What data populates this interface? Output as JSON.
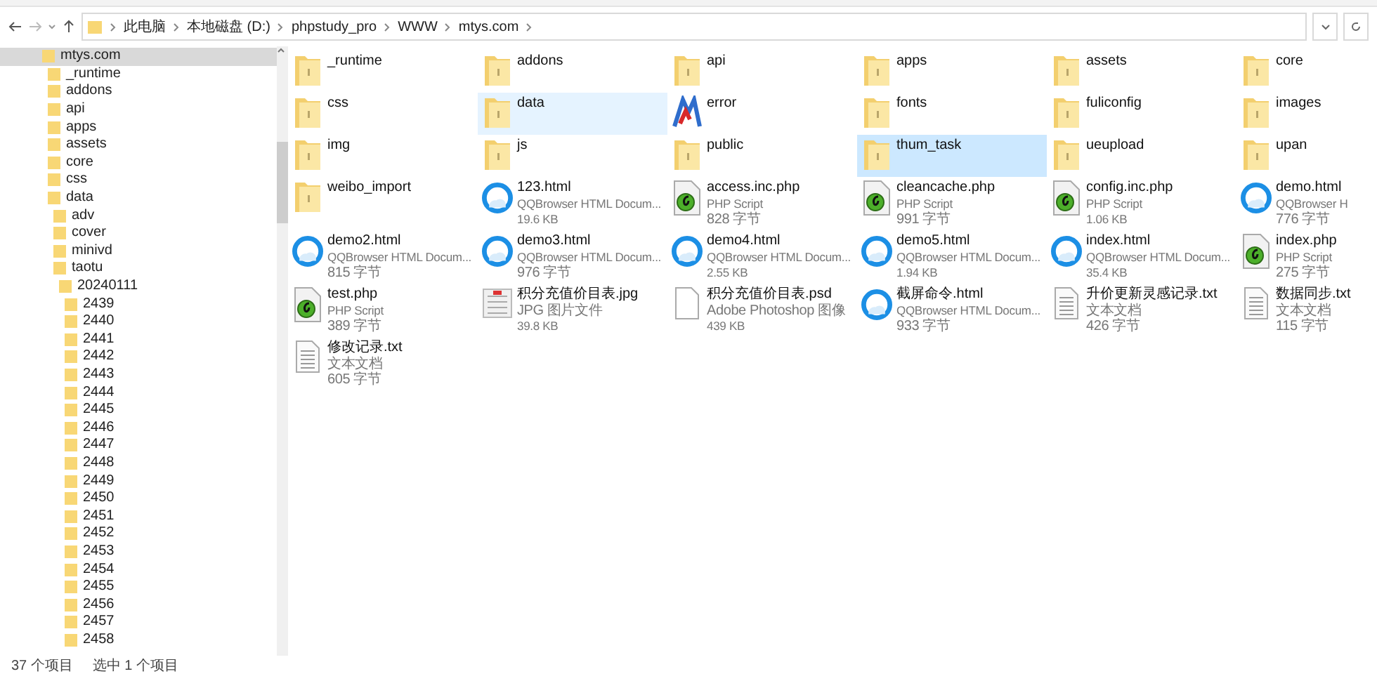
{
  "breadcrumb": [
    "此电脑",
    "本地磁盘 (D:)",
    "phpstudy_pro",
    "WWW",
    "mtys.com"
  ],
  "tree": [
    {
      "label": "mtys.com",
      "selected": true,
      "children": [
        {
          "label": "_runtime",
          "selected": false
        },
        {
          "label": "addons",
          "selected": false
        },
        {
          "label": "api",
          "selected": false
        },
        {
          "label": "apps",
          "selected": false
        },
        {
          "label": "assets",
          "selected": false
        },
        {
          "label": "core",
          "selected": false
        },
        {
          "label": "css",
          "selected": false
        },
        {
          "label": "data",
          "selected": false,
          "children": [
            {
              "label": "adv",
              "selected": false
            },
            {
              "label": "cover",
              "selected": false
            },
            {
              "label": "minivd",
              "selected": false
            },
            {
              "label": "taotu",
              "selected": false,
              "children": [
                {
                  "label": "20240111",
                  "selected": false,
                  "children": [
                    {
                      "label": "2439",
                      "selected": false
                    },
                    {
                      "label": "2440",
                      "selected": false
                    },
                    {
                      "label": "2441",
                      "selected": false
                    },
                    {
                      "label": "2442",
                      "selected": false
                    },
                    {
                      "label": "2443",
                      "selected": false
                    },
                    {
                      "label": "2444",
                      "selected": false
                    },
                    {
                      "label": "2445",
                      "selected": false
                    },
                    {
                      "label": "2446",
                      "selected": false
                    },
                    {
                      "label": "2447",
                      "selected": false
                    },
                    {
                      "label": "2448",
                      "selected": false
                    },
                    {
                      "label": "2449",
                      "selected": false
                    },
                    {
                      "label": "2450",
                      "selected": false
                    },
                    {
                      "label": "2451",
                      "selected": false
                    },
                    {
                      "label": "2452",
                      "selected": false
                    },
                    {
                      "label": "2453",
                      "selected": false
                    },
                    {
                      "label": "2454",
                      "selected": false
                    },
                    {
                      "label": "2455",
                      "selected": false
                    },
                    {
                      "label": "2456",
                      "selected": false
                    },
                    {
                      "label": "2457",
                      "selected": false
                    },
                    {
                      "label": "2458",
                      "selected": false
                    }
                  ]
                }
              ]
            }
          ]
        }
      ]
    }
  ],
  "items": [
    {
      "kind": "folder",
      "name": "_runtime",
      "selected": false,
      "hovered": false
    },
    {
      "kind": "folder",
      "name": "addons",
      "selected": false,
      "hovered": false
    },
    {
      "kind": "folder",
      "name": "api",
      "selected": false,
      "hovered": false
    },
    {
      "kind": "folder",
      "name": "apps",
      "selected": false,
      "hovered": false
    },
    {
      "kind": "folder",
      "name": "assets",
      "selected": false,
      "hovered": false
    },
    {
      "kind": "folder",
      "name": "core",
      "selected": false,
      "hovered": false
    },
    {
      "kind": "folder",
      "name": "css",
      "selected": false,
      "hovered": false
    },
    {
      "kind": "folder",
      "name": "data",
      "selected": false,
      "hovered": true
    },
    {
      "kind": "app",
      "name": "error",
      "selected": false,
      "hovered": false
    },
    {
      "kind": "folder",
      "name": "fonts",
      "selected": false,
      "hovered": false
    },
    {
      "kind": "folder",
      "name": "fuliconfig",
      "selected": false,
      "hovered": false
    },
    {
      "kind": "folder",
      "name": "images",
      "selected": false,
      "hovered": false
    },
    {
      "kind": "folder",
      "name": "img",
      "selected": false,
      "hovered": false
    },
    {
      "kind": "folder",
      "name": "js",
      "selected": false,
      "hovered": false
    },
    {
      "kind": "folder",
      "name": "public",
      "selected": false,
      "hovered": false
    },
    {
      "kind": "folder",
      "name": "thum_task",
      "selected": true,
      "hovered": false
    },
    {
      "kind": "folder",
      "name": "ueupload",
      "selected": false,
      "hovered": false
    },
    {
      "kind": "folder",
      "name": "upan",
      "selected": false,
      "hovered": false
    },
    {
      "kind": "folder",
      "name": "weibo_import",
      "selected": false,
      "hovered": false
    },
    {
      "kind": "html",
      "name": "123.html",
      "type": "QQBrowser HTML Docum...",
      "size": "19.6 KB",
      "selected": false,
      "hovered": false
    },
    {
      "kind": "php",
      "name": "access.inc.php",
      "type": "PHP Script",
      "size": "828 字节",
      "selected": false,
      "hovered": false
    },
    {
      "kind": "php",
      "name": "cleancache.php",
      "type": "PHP Script",
      "size": "991 字节",
      "selected": false,
      "hovered": false
    },
    {
      "kind": "php",
      "name": "config.inc.php",
      "type": "PHP Script",
      "size": "1.06 KB",
      "selected": false,
      "hovered": false
    },
    {
      "kind": "html",
      "name": "demo.html",
      "type": "QQBrowser H",
      "size": "776 字节",
      "selected": false,
      "hovered": false
    },
    {
      "kind": "html",
      "name": "demo2.html",
      "type": "QQBrowser HTML Docum...",
      "size": "815 字节",
      "selected": false,
      "hovered": false
    },
    {
      "kind": "html",
      "name": "demo3.html",
      "type": "QQBrowser HTML Docum...",
      "size": "976 字节",
      "selected": false,
      "hovered": false
    },
    {
      "kind": "html",
      "name": "demo4.html",
      "type": "QQBrowser HTML Docum...",
      "size": "2.55 KB",
      "selected": false,
      "hovered": false
    },
    {
      "kind": "html",
      "name": "demo5.html",
      "type": "QQBrowser HTML Docum...",
      "size": "1.94 KB",
      "selected": false,
      "hovered": false
    },
    {
      "kind": "html",
      "name": "index.html",
      "type": "QQBrowser HTML Docum...",
      "size": "35.4 KB",
      "selected": false,
      "hovered": false
    },
    {
      "kind": "php",
      "name": "index.php",
      "type": "PHP Script",
      "size": "275 字节",
      "selected": false,
      "hovered": false
    },
    {
      "kind": "php",
      "name": "test.php",
      "type": "PHP Script",
      "size": "389 字节",
      "selected": false,
      "hovered": false
    },
    {
      "kind": "image",
      "name": "积分充值价目表.jpg",
      "type": "JPG 图片文件",
      "size": "39.8 KB",
      "selected": false,
      "hovered": false
    },
    {
      "kind": "blank",
      "name": "积分充值价目表.psd",
      "type": "Adobe Photoshop 图像",
      "size": "439 KB",
      "selected": false,
      "hovered": false
    },
    {
      "kind": "html",
      "name": "截屏命令.html",
      "type": "QQBrowser HTML Docum...",
      "size": "933 字节",
      "selected": false,
      "hovered": false
    },
    {
      "kind": "text",
      "name": "升价更新灵感记录.txt",
      "type": "文本文档",
      "size": "426 字节",
      "selected": false,
      "hovered": false
    },
    {
      "kind": "text",
      "name": "数据同步.txt",
      "type": "文本文档",
      "size": "115 字节",
      "selected": false,
      "hovered": false
    },
    {
      "kind": "text",
      "name": "修改记录.txt",
      "type": "文本文档",
      "size": "605 字节",
      "selected": false,
      "hovered": false
    }
  ],
  "status_bar": {
    "count": "37 个项目",
    "selection": "选中 1 个项目"
  }
}
